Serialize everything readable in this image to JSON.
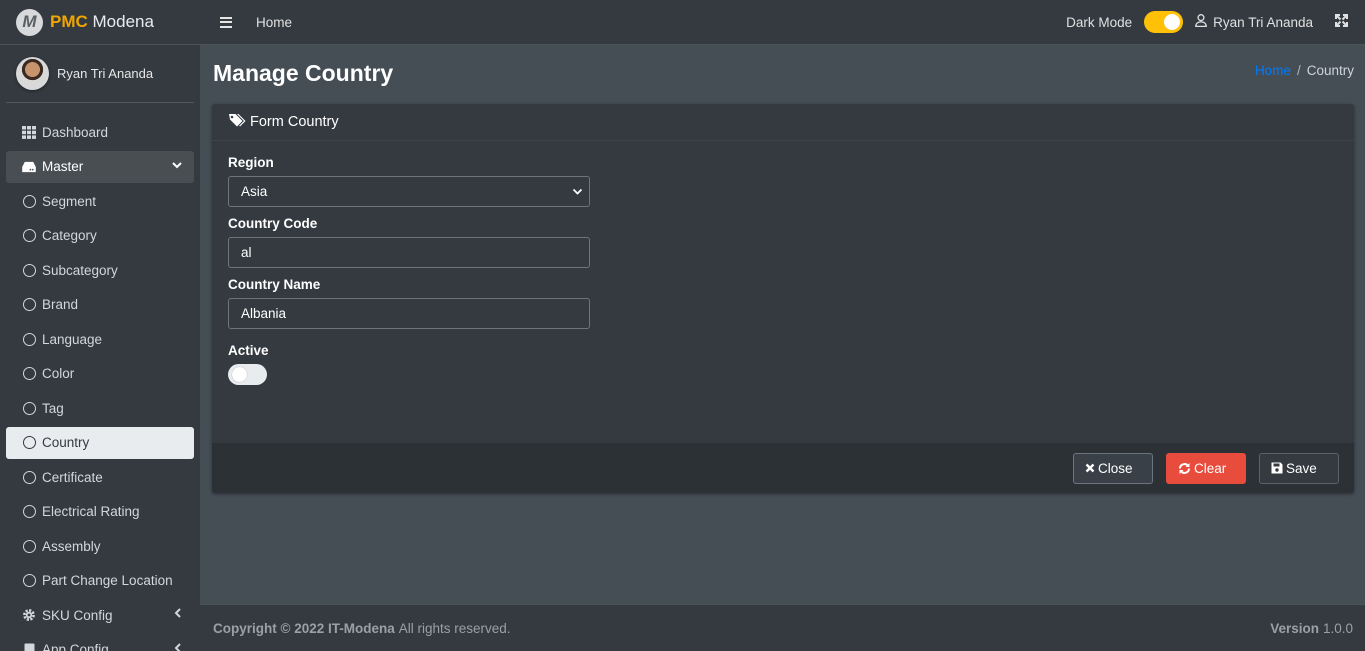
{
  "brand": {
    "logo_letter": "M",
    "name_accent": "PMC",
    "name_rest": "Modena"
  },
  "sidebar": {
    "user_name": "Ryan Tri Ananda",
    "items": [
      {
        "label": "Dashboard",
        "icon": "grid-icon"
      },
      {
        "label": "Master",
        "icon": "hdd-icon",
        "state": "open"
      },
      {
        "label": "Segment",
        "icon": "circle-icon"
      },
      {
        "label": "Category",
        "icon": "circle-icon"
      },
      {
        "label": "Subcategory",
        "icon": "circle-icon"
      },
      {
        "label": "Brand",
        "icon": "circle-icon"
      },
      {
        "label": "Language",
        "icon": "circle-icon"
      },
      {
        "label": "Color",
        "icon": "circle-icon"
      },
      {
        "label": "Tag",
        "icon": "circle-icon"
      },
      {
        "label": "Country",
        "icon": "circle-icon",
        "state": "active"
      },
      {
        "label": "Certificate",
        "icon": "circle-icon"
      },
      {
        "label": "Electrical Rating",
        "icon": "circle-icon"
      },
      {
        "label": "Assembly",
        "icon": "circle-icon"
      },
      {
        "label": "Part Change Location",
        "icon": "circle-icon"
      },
      {
        "label": "SKU Config",
        "icon": "gear-icon"
      },
      {
        "label": "App Config",
        "icon": "doc-icon"
      }
    ]
  },
  "topbar": {
    "home_label": "Home",
    "dark_mode_label": "Dark Mode",
    "dark_mode_on": true,
    "user_name": "Ryan Tri Ananda"
  },
  "page": {
    "title": "Manage Country",
    "breadcrumb": {
      "home": "Home",
      "separator": "/",
      "current": "Country"
    }
  },
  "form": {
    "header": "Form Country",
    "region_label": "Region",
    "region_value": "Asia",
    "code_label": "Country Code",
    "code_value": "al",
    "name_label": "Country Name",
    "name_value": "Albania",
    "active_label": "Active",
    "active_on": false
  },
  "buttons": {
    "close": "Close",
    "clear": "Clear",
    "save": "Save"
  },
  "footer": {
    "copyright": "Copyright © 2022 IT-Modena",
    "rights": "All rights reserved.",
    "version_label": "Version",
    "version_value": "1.0.0"
  },
  "colors": {
    "accent": "#ffc107",
    "link": "#007bff",
    "danger": "#e74c3c",
    "brand_accent": "#f0a500"
  }
}
